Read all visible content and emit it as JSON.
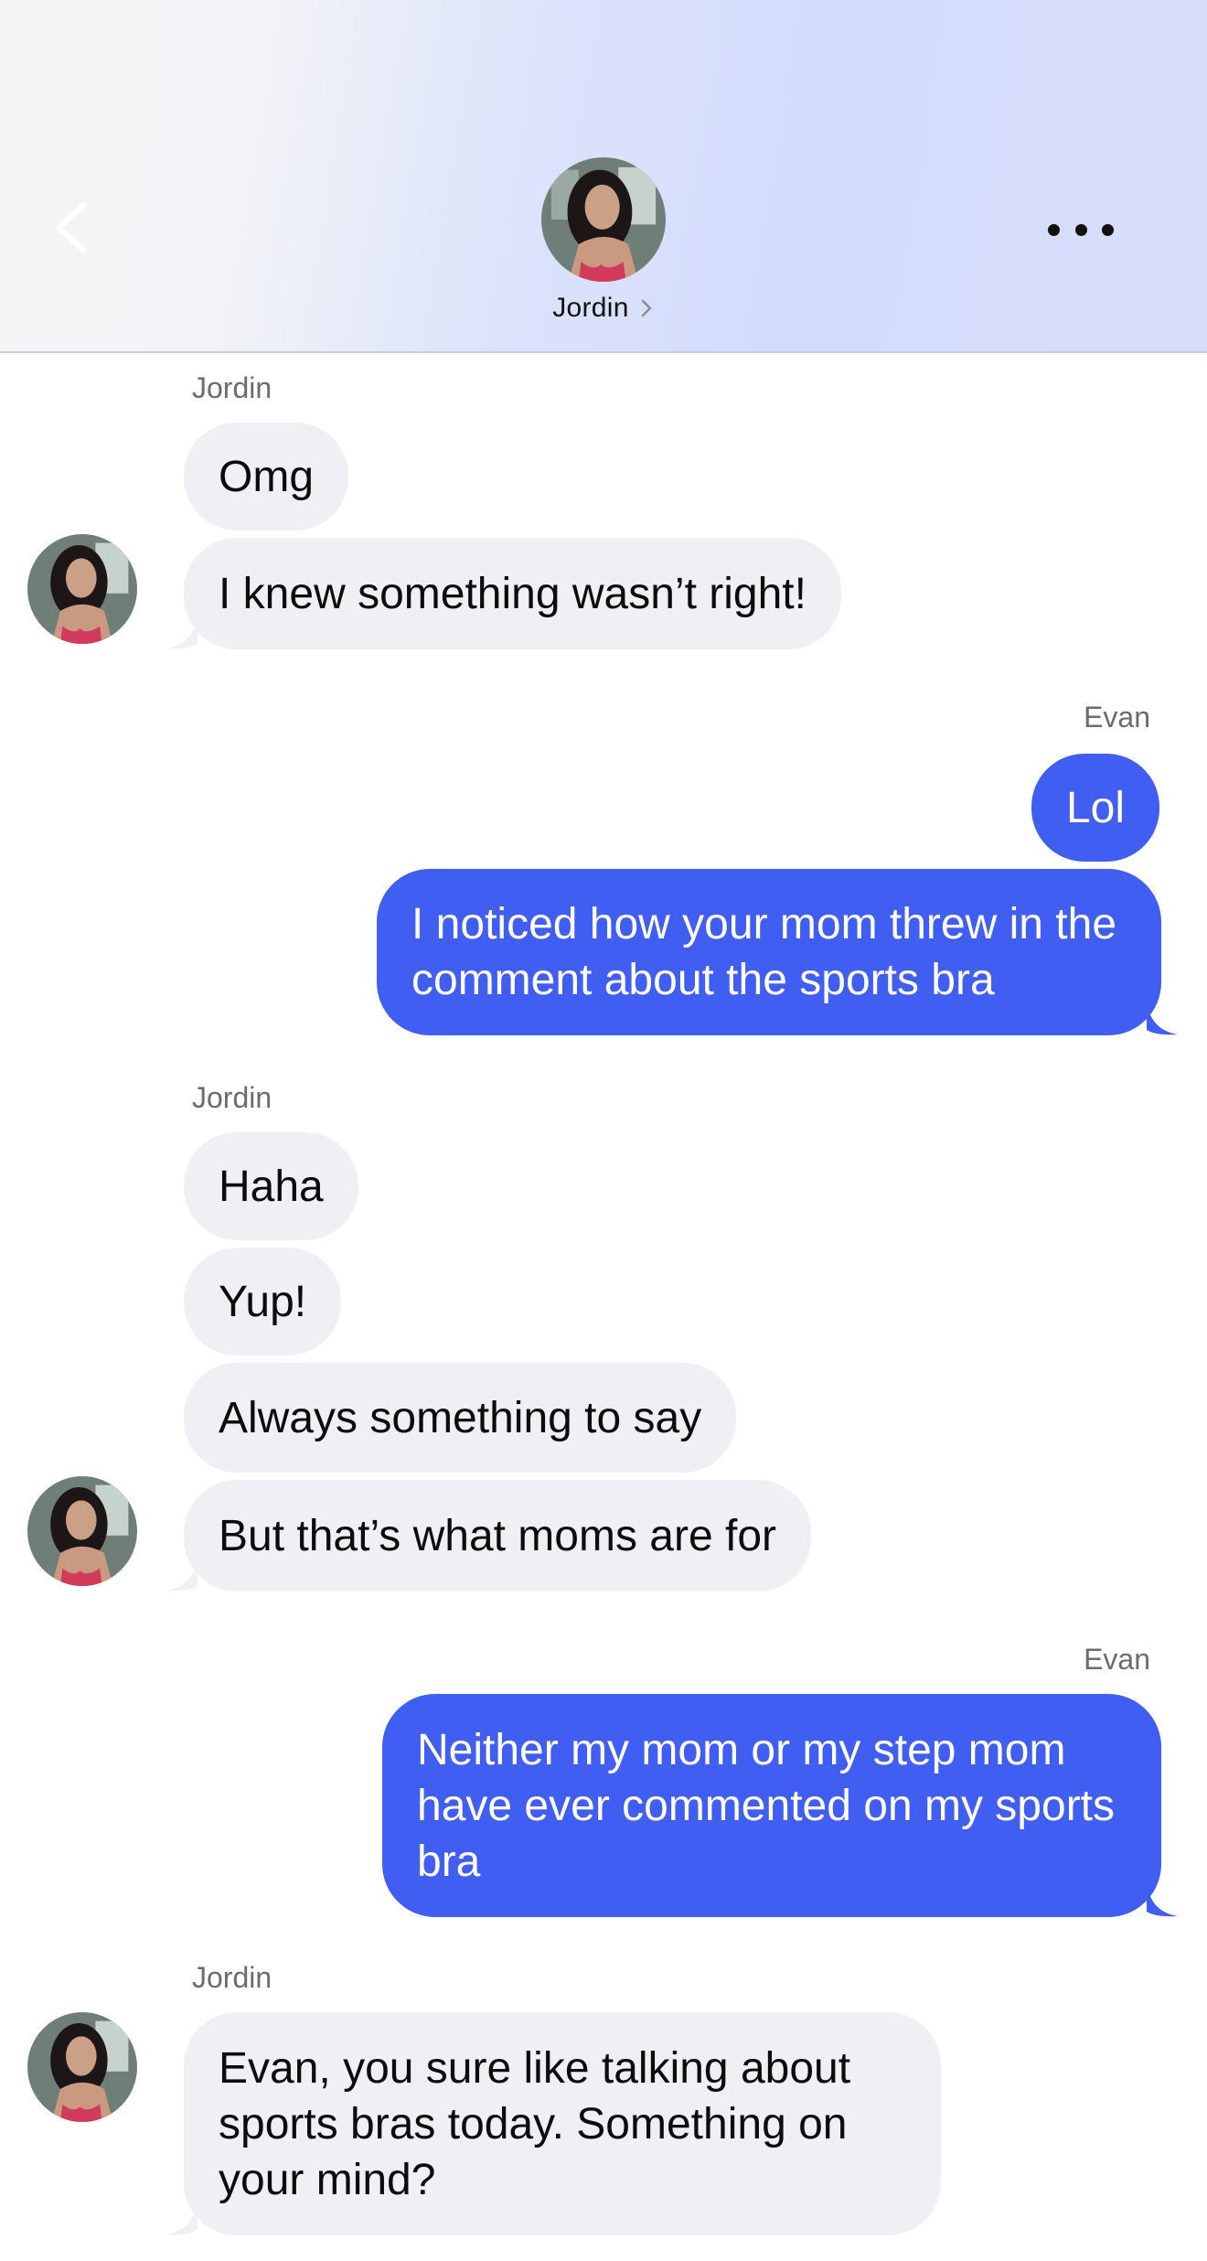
{
  "header": {
    "contact_name": "Jordin",
    "back_icon": "chevron-left-icon",
    "more_icon": "ellipsis-icon",
    "chevron_icon": "chevron-right-icon"
  },
  "colors": {
    "outgoing_bubble": "#415ef2",
    "incoming_bubble": "#f0f0f4",
    "sender_label": "#6b6b70"
  },
  "messages": [
    {
      "sender": "Jordin",
      "text": "Omg"
    },
    {
      "sender": "Jordin",
      "text": "I knew something wasn’t right!"
    },
    {
      "sender": "Evan",
      "text": "Lol"
    },
    {
      "sender": "Evan",
      "text": "I noticed how your mom threw in the comment about the sports bra"
    },
    {
      "sender": "Jordin",
      "text": "Haha"
    },
    {
      "sender": "Jordin",
      "text": "Yup!"
    },
    {
      "sender": "Jordin",
      "text": "Always something to say"
    },
    {
      "sender": "Jordin",
      "text": "But that’s what moms are for"
    },
    {
      "sender": "Evan",
      "text": "Neither my mom or my step mom have ever commented on my sports bra"
    },
    {
      "sender": "Jordin",
      "text": "Evan, you sure like talking about sports bras today. Something on your mind?"
    }
  ],
  "senders": {
    "group1": "Jordin",
    "group2": "Evan",
    "group3": "Jordin",
    "group4": "Evan",
    "group5": "Jordin"
  }
}
